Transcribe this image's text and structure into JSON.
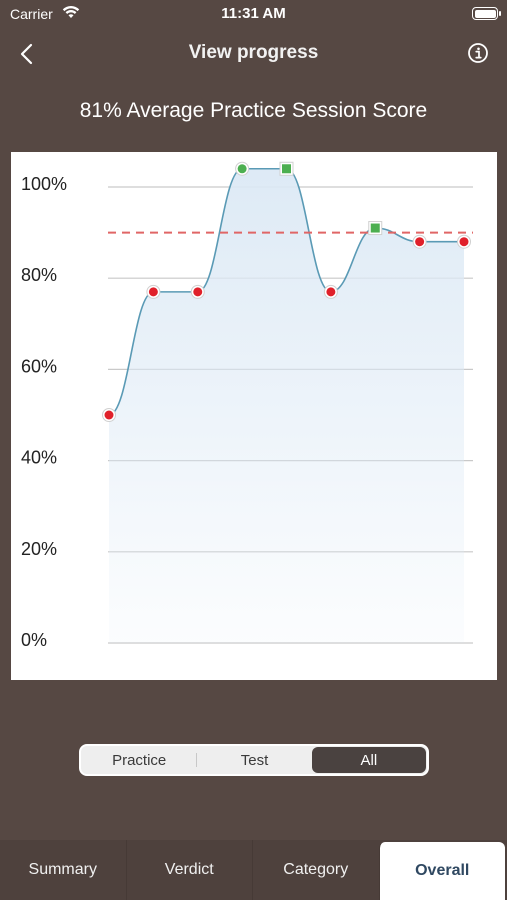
{
  "status_bar": {
    "carrier": "Carrier",
    "time": "11:31 AM",
    "icons": [
      "wifi-icon",
      "battery-icon"
    ]
  },
  "nav": {
    "title": "View progress",
    "back_icon": "chevron-left-icon",
    "info_icon": "info-icon"
  },
  "summary": {
    "title": "81% Average Practice Session Score"
  },
  "chart_data": {
    "type": "line",
    "y_ticks": [
      "100%",
      "80%",
      "60%",
      "40%",
      "20%",
      "0%"
    ],
    "ylim": [
      0,
      100
    ],
    "points": [
      {
        "value": 50,
        "kind": "practice-circle",
        "color": "#e0202a"
      },
      {
        "value": 77,
        "kind": "practice-circle",
        "color": "#e0202a"
      },
      {
        "value": 77,
        "kind": "practice-circle",
        "color": "#e0202a"
      },
      {
        "value": 104,
        "kind": "practice-circle",
        "color": "#4caf50"
      },
      {
        "value": 104,
        "kind": "test-square",
        "color": "#4caf50"
      },
      {
        "value": 77,
        "kind": "practice-circle",
        "color": "#e0202a"
      },
      {
        "value": 91,
        "kind": "test-square",
        "color": "#4caf50"
      },
      {
        "value": 88,
        "kind": "practice-circle",
        "color": "#e0202a"
      },
      {
        "value": 88,
        "kind": "practice-circle",
        "color": "#e0202a"
      }
    ],
    "target_value": 90,
    "line_color": "#5a9ab5",
    "fill_color": "#dce9f5",
    "target_color": "#e06666",
    "grid": true
  },
  "segmented": {
    "options": [
      "Practice",
      "Test",
      "All"
    ],
    "selected": "All"
  },
  "tabs": [
    {
      "label": "Summary",
      "active": false
    },
    {
      "label": "Verdict",
      "active": false
    },
    {
      "label": "Category",
      "active": false
    },
    {
      "label": "Overall",
      "active": true
    }
  ]
}
